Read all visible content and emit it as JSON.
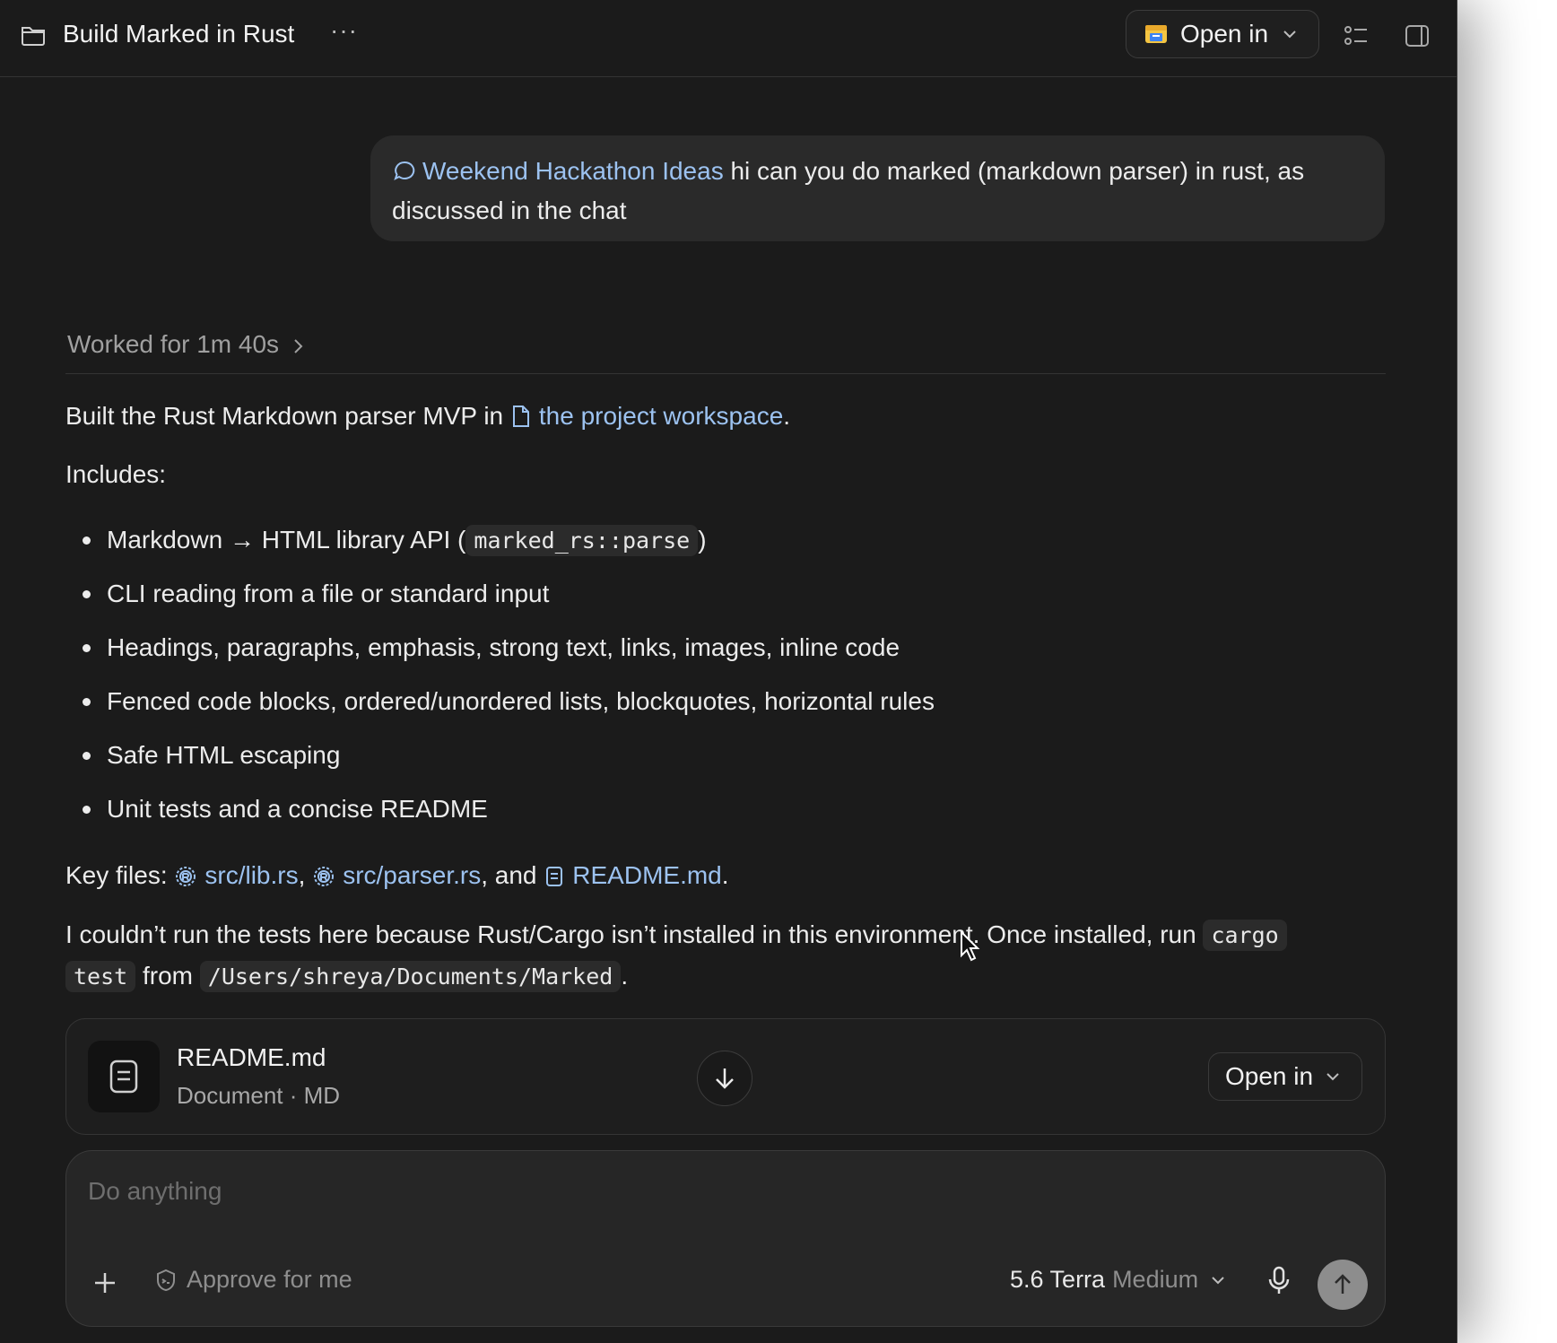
{
  "header": {
    "title": "Build Marked in Rust",
    "more_label": "···",
    "open_in_label": "Open in"
  },
  "user_message": {
    "chip_label": "Weekend Hackathon Ideas",
    "text": " hi can you do marked (markdown parser) in rust, as discussed in the chat"
  },
  "worked": {
    "label": "Worked for 1m 40s"
  },
  "response": {
    "intro_prefix": "Built the Rust Markdown parser MVP in ",
    "intro_link": "the project workspace",
    "intro_suffix": ".",
    "includes_label": "Includes:",
    "bullets": [
      {
        "prefix": "Markdown → HTML library API (",
        "code": "marked_rs::parse",
        "suffix": ")"
      },
      {
        "text": "CLI reading from a file or standard input"
      },
      {
        "text": "Headings, paragraphs, emphasis, strong text, links, images, inline code"
      },
      {
        "text": "Fenced code blocks, ordered/unordered lists, blockquotes, horizontal rules"
      },
      {
        "text": "Safe HTML escaping"
      },
      {
        "text": "Unit tests and a concise README"
      }
    ],
    "key_files_label": "Key files: ",
    "key_files": [
      "src/lib.rs",
      "src/parser.rs",
      "README.md"
    ],
    "key_sep_1": ",",
    "key_sep_2": ", and",
    "key_end": ".",
    "note_line1": "I couldn’t run the tests here because Rust/Cargo isn’t installed in this environment. Once installed, run ",
    "note_code1a": "cargo",
    "note_code1b": "test",
    "note_from": " from ",
    "note_code2": "/Users/shreya/Documents/Marked",
    "note_end": "."
  },
  "file_card": {
    "name": "README.md",
    "subtitle": "Document · MD",
    "open_in_label": "Open in"
  },
  "composer": {
    "placeholder": "Do anything",
    "approve_label": "Approve for me",
    "model_name": "5.6 Terra",
    "model_effort": "Medium"
  },
  "icons": {
    "folder": "folder-icon",
    "list": "list-icon",
    "panel": "sidebar-panel-icon",
    "chat": "chat-bubble-icon",
    "file": "file-icon",
    "rust": "rust-icon",
    "doc": "document-icon",
    "download": "download-arrow-icon",
    "plus": "plus-icon",
    "shield": "shield-icon",
    "mic": "microphone-icon",
    "send": "send-arrow-icon"
  },
  "colors": {
    "background": "#1b1b1b",
    "link": "#9cc2f0",
    "bubble": "#2a2a2a",
    "send_button": "#8d8d8d"
  }
}
